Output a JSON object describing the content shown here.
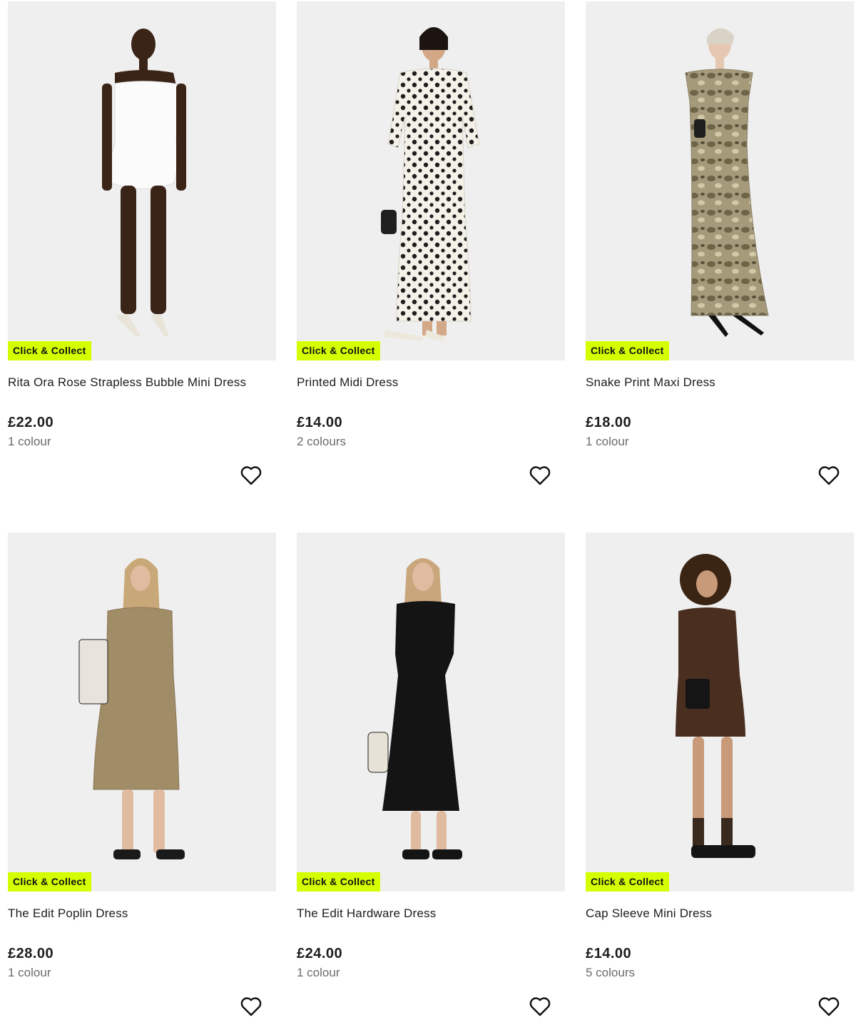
{
  "badge_color": "#d4ff00",
  "products": [
    {
      "name": "Rita Ora Rose Strapless Bubble Mini Dress",
      "price": "£22.00",
      "colours": "1 colour",
      "badge": "Click & Collect",
      "icon": "heart-icon"
    },
    {
      "name": "Printed Midi Dress",
      "price": "£14.00",
      "colours": "2 colours",
      "badge": "Click & Collect",
      "icon": "heart-icon"
    },
    {
      "name": "Snake Print Maxi Dress",
      "price": "£18.00",
      "colours": "1 colour",
      "badge": "Click & Collect",
      "icon": "heart-icon"
    },
    {
      "name": "The Edit Poplin Dress",
      "price": "£28.00",
      "colours": "1 colour",
      "badge": "Click & Collect",
      "icon": "heart-icon"
    },
    {
      "name": "The Edit Hardware Dress",
      "price": "£24.00",
      "colours": "1 colour",
      "badge": "Click & Collect",
      "icon": "heart-icon"
    },
    {
      "name": "Cap Sleeve Mini Dress",
      "price": "£14.00",
      "colours": "5 colours",
      "badge": "Click & Collect",
      "icon": "heart-icon"
    }
  ]
}
